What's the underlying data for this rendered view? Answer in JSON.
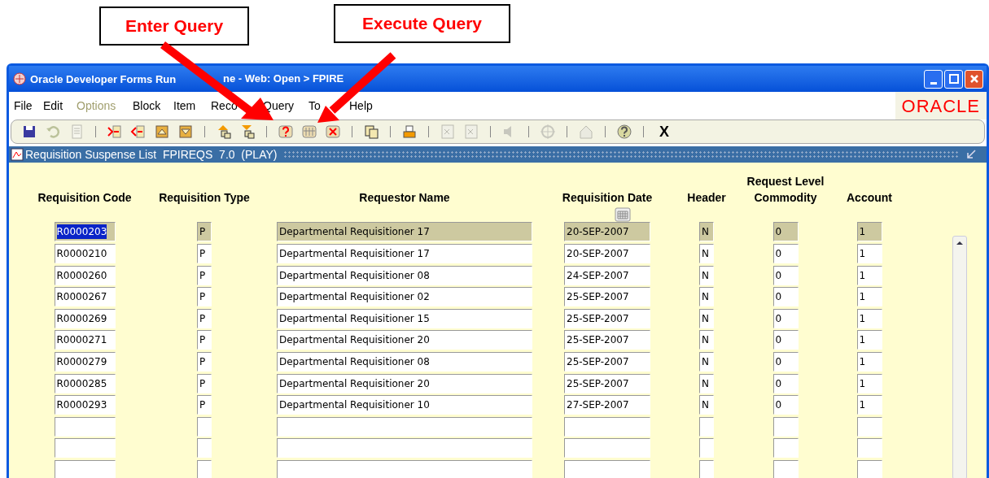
{
  "callouts": [
    {
      "label": "Enter Query"
    },
    {
      "label": "Execute Query"
    }
  ],
  "window": {
    "title_parts": [
      "Oracle Developer Forms Run",
      "ne - Web:  Open > FPIRE"
    ]
  },
  "menu": [
    {
      "label": "File",
      "disabled": false
    },
    {
      "label": "Edit",
      "disabled": false
    },
    {
      "label": "Options",
      "disabled": true
    },
    {
      "label": "Block",
      "disabled": false
    },
    {
      "label": "Item",
      "disabled": false
    },
    {
      "label": "Reco",
      "disabled": false
    },
    {
      "label": "Query",
      "disabled": false
    },
    {
      "label": "To",
      "disabled": false
    },
    {
      "label": "Help",
      "disabled": false
    }
  ],
  "logo": "ORACLE",
  "toolbar": {
    "exit_label": "X"
  },
  "form": {
    "title": "Requisition Suspense List  FPIREQS  7.0  (PLAY)",
    "columns": [
      "Requisition Code",
      "Requisition Type",
      "Requestor Name",
      "Requisition Date",
      "Header",
      "Request Level Commodity",
      "Account"
    ],
    "rows": [
      {
        "current": true,
        "code": "R0000203",
        "type": "P",
        "requestor": "Departmental Requisitioner 17",
        "date": "20-SEP-2007",
        "header": "N",
        "commodity": "0",
        "account": "1"
      },
      {
        "current": false,
        "code": "R0000210",
        "type": "P",
        "requestor": "Departmental Requisitioner 17",
        "date": "20-SEP-2007",
        "header": "N",
        "commodity": "0",
        "account": "1"
      },
      {
        "current": false,
        "code": "R0000260",
        "type": "P",
        "requestor": "Departmental Requisitioner 08",
        "date": "24-SEP-2007",
        "header": "N",
        "commodity": "0",
        "account": "1"
      },
      {
        "current": false,
        "code": "R0000267",
        "type": "P",
        "requestor": "Departmental Requisitioner 02",
        "date": "25-SEP-2007",
        "header": "N",
        "commodity": "0",
        "account": "1"
      },
      {
        "current": false,
        "code": "R0000269",
        "type": "P",
        "requestor": "Departmental Requisitioner 15",
        "date": "25-SEP-2007",
        "header": "N",
        "commodity": "0",
        "account": "1"
      },
      {
        "current": false,
        "code": "R0000271",
        "type": "P",
        "requestor": "Departmental Requisitioner 20",
        "date": "25-SEP-2007",
        "header": "N",
        "commodity": "0",
        "account": "1"
      },
      {
        "current": false,
        "code": "R0000279",
        "type": "P",
        "requestor": "Departmental Requisitioner 08",
        "date": "25-SEP-2007",
        "header": "N",
        "commodity": "0",
        "account": "1"
      },
      {
        "current": false,
        "code": "R0000285",
        "type": "P",
        "requestor": "Departmental Requisitioner 20",
        "date": "25-SEP-2007",
        "header": "N",
        "commodity": "0",
        "account": "1"
      },
      {
        "current": false,
        "code": "R0000293",
        "type": "P",
        "requestor": "Departmental Requisitioner 10",
        "date": "27-SEP-2007",
        "header": "N",
        "commodity": "0",
        "account": "1"
      },
      {
        "current": false
      },
      {
        "current": false
      },
      {
        "current": false
      }
    ]
  }
}
